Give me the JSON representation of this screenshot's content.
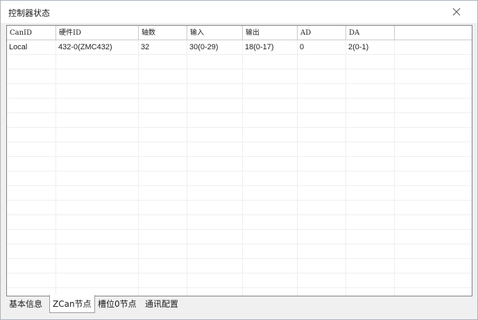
{
  "window": {
    "title": "控制器状态"
  },
  "icons": {
    "close": "close-icon"
  },
  "grid": {
    "columns": [
      "CanID",
      "硬件ID",
      "轴数",
      "输入",
      "输出",
      "AD",
      "DA"
    ],
    "rows": [
      [
        "Local",
        "432-0(ZMC432)",
        "32",
        "30(0-29)",
        "18(0-17)",
        "0",
        "2(0-1)"
      ]
    ],
    "empty_row_count": 17
  },
  "tabs": [
    {
      "label": "基本信息",
      "active": false
    },
    {
      "label": "ZCan节点",
      "active": true
    },
    {
      "label": "槽位0节点",
      "active": false
    },
    {
      "label": "通讯配置",
      "active": false
    }
  ]
}
